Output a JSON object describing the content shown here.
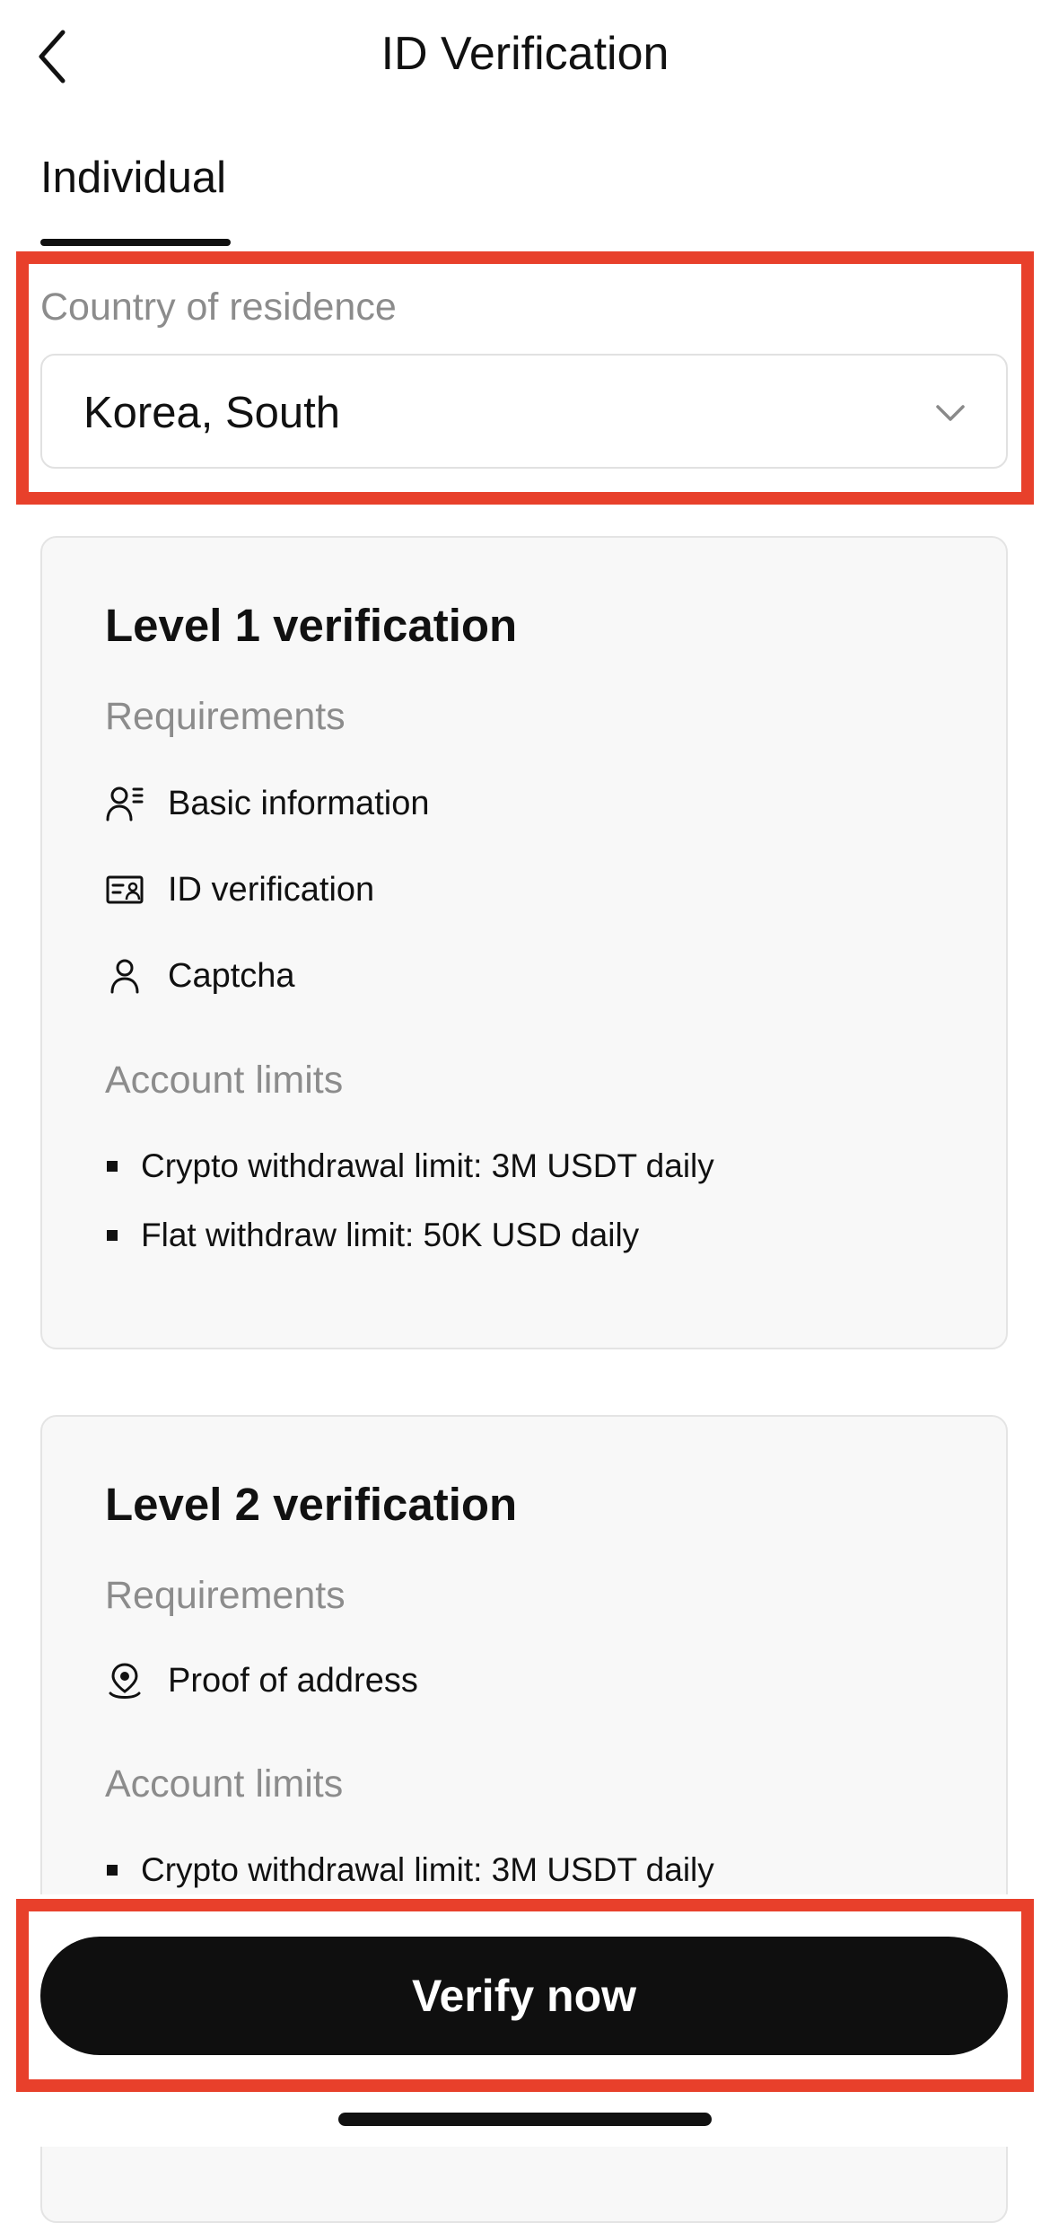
{
  "header": {
    "title": "ID Verification",
    "back_icon": "chevron-left-icon"
  },
  "tabs": [
    {
      "label": "Individual",
      "selected": true
    }
  ],
  "country": {
    "label": "Country of residence",
    "value": "Korea, South",
    "icon": "chevron-down-icon"
  },
  "levels": [
    {
      "title": "Level 1 verification",
      "requirements_label": "Requirements",
      "requirements": [
        {
          "label": "Basic information",
          "icon": "user-info-icon"
        },
        {
          "label": "ID verification",
          "icon": "id-card-icon"
        },
        {
          "label": "Captcha",
          "icon": "user-icon"
        }
      ],
      "limits_label": "Account limits",
      "limits": [
        "Crypto withdrawal limit: 3M USDT daily",
        "Flat withdraw limit: 50K USD daily"
      ]
    },
    {
      "title": "Level 2 verification",
      "requirements_label": "Requirements",
      "requirements": [
        {
          "label": "Proof of address",
          "icon": "location-pin-icon"
        }
      ],
      "limits_label": "Account limits",
      "limits": [
        "Crypto withdrawal limit: 3M USDT daily"
      ]
    }
  ],
  "footer": {
    "verify_label": "Verify now"
  },
  "colors": {
    "highlight": "#e8402b",
    "button": "#0f0f0f"
  }
}
